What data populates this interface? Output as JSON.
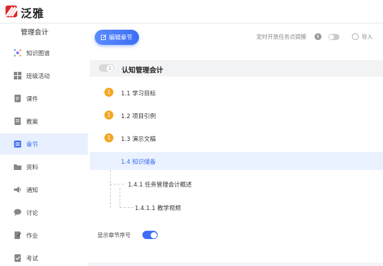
{
  "brand": {
    "name": "泛雅"
  },
  "sidebar": {
    "course_title": "管理会计",
    "items": [
      {
        "label": "知识图谱",
        "icon": "knowledge-graph-icon"
      },
      {
        "label": "班级活动",
        "icon": "class-activity-icon"
      },
      {
        "label": "课件",
        "icon": "courseware-icon"
      },
      {
        "label": "教案",
        "icon": "lesson-plan-icon"
      },
      {
        "label": "章节",
        "icon": "chapter-icon",
        "active": true
      },
      {
        "label": "资料",
        "icon": "folder-icon"
      },
      {
        "label": "通知",
        "icon": "megaphone-icon"
      },
      {
        "label": "讨论",
        "icon": "chat-icon"
      },
      {
        "label": "作业",
        "icon": "homework-icon"
      },
      {
        "label": "考试",
        "icon": "exam-icon"
      }
    ]
  },
  "toolbar": {
    "edit_label": "编辑章节",
    "timer_label": "定时开放任务点提醒",
    "import_label": "导入"
  },
  "chapter": {
    "number": "1",
    "title": "认知管理会计",
    "sections": [
      {
        "badge": "1",
        "label": "1.1 学习目标"
      },
      {
        "badge": "1",
        "label": "1.2 项目引例"
      },
      {
        "badge": "1",
        "label": "1.3 演示文稿"
      },
      {
        "badge": "",
        "label": "1.4 知识储备",
        "active": true
      },
      {
        "badge": "",
        "label": "1.4.1 任务管理会计概述"
      },
      {
        "badge": "",
        "label": "1.4.1.1 教学视频"
      }
    ]
  },
  "footer": {
    "show_number_label": "显示章节序号"
  },
  "colors": {
    "accent": "#3d6ef5",
    "badge": "#f5a623",
    "brand": "#e02727"
  }
}
